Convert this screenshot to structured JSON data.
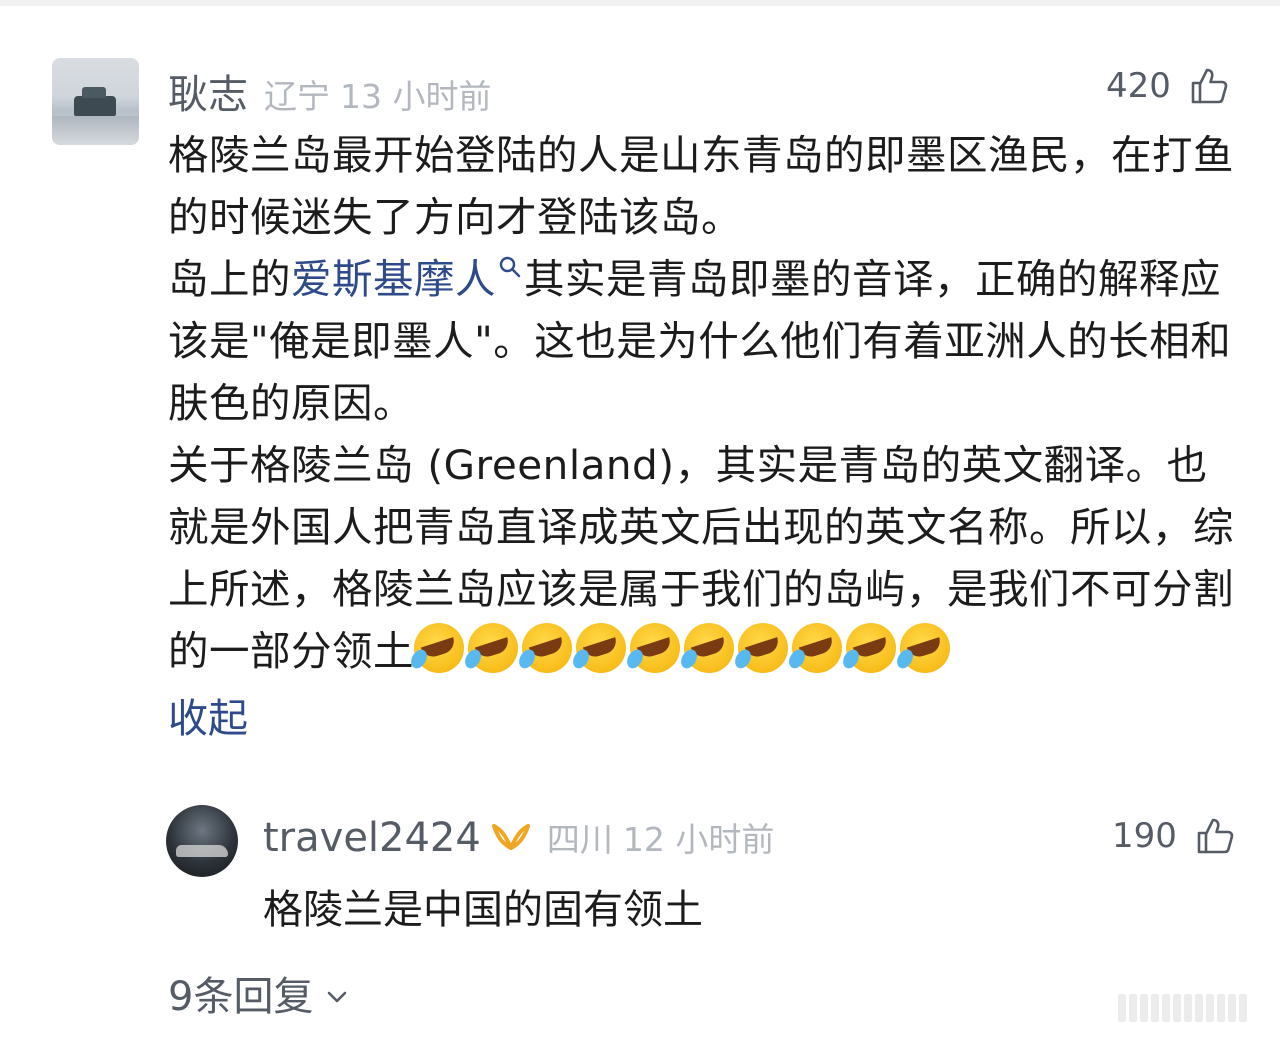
{
  "comment": {
    "username": "耿志",
    "location": "辽宁",
    "time": "13 小时前",
    "likes": "420",
    "body_before_link": "格陵兰岛最开始登陆的人是山东青岛的即墨区渔民，在打鱼的时候迷失了方向才登陆该岛。\n岛上的",
    "link_text": "爱斯基摩人",
    "body_after_link": "其实是青岛即墨的音译，正确的解释应该是\"俺是即墨人\"。这也是为什么他们有着亚洲人的长相和肤色的原因。\n关于格陵兰岛 (Greenland)，其实是青岛的英文翻译。也就是外国人把青岛直译成英文后出现的英文名称。所以，综上所述，格陵兰岛应该是属于我们的岛屿，是我们不可分割的一部分领土",
    "emoji_name": "cry-laugh-emoji",
    "emoji_count": 10,
    "collapse_label": "收起"
  },
  "reply": {
    "username": "travel2424",
    "location": "四川",
    "time": "12 小时前",
    "likes": "190",
    "body": "格陵兰是中国的固有领土"
  },
  "more_replies_label": "9条回复",
  "icons": {
    "like": "thumbs-up-icon",
    "search": "search-icon",
    "vip": "vip-badge-icon",
    "chevron": "chevron-down-icon"
  },
  "colors": {
    "link": "#2e4a8a",
    "meta": "#b3b8bf",
    "username": "#555c66",
    "vip": "#f0a623"
  }
}
